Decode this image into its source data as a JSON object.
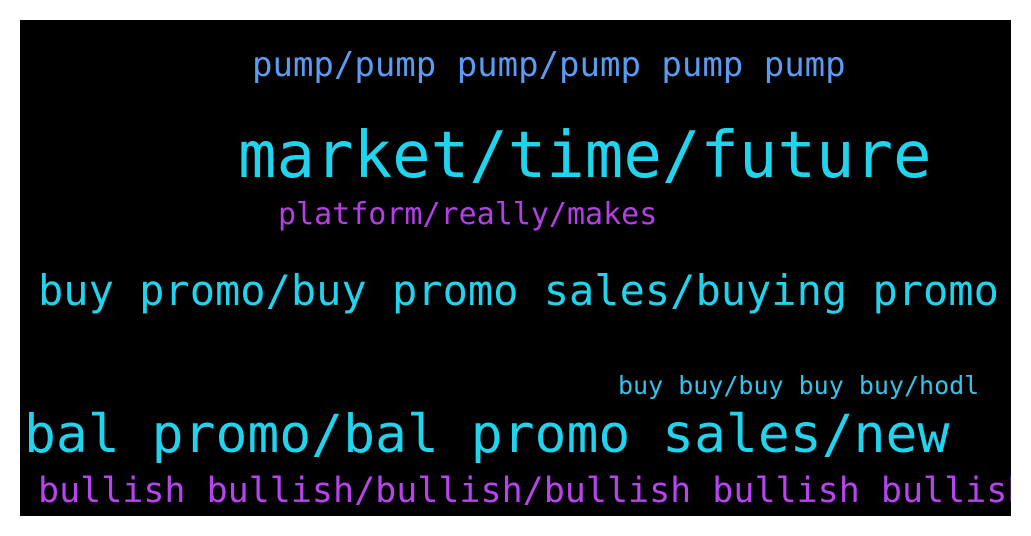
{
  "background_color": "#000000",
  "frame_color": "#ffffff",
  "words": [
    {
      "text": "pump/pump pump/pump pump pump",
      "color": "#5a9cf2"
    },
    {
      "text": "market/time/future",
      "color": "#22d3ee"
    },
    {
      "text": "platform/really/makes",
      "color": "#b43fe6"
    },
    {
      "text": "buy promo/buy promo sales/buying promo",
      "color": "#22d3ee"
    },
    {
      "text": "buy buy/buy buy buy/hodl",
      "color": "#36c3ea"
    },
    {
      "text": "bal promo/bal promo sales/new",
      "color": "#22d3ee"
    },
    {
      "text": "bullish bullish/bullish/bullish bullish bullish",
      "color": "#b844f0"
    }
  ]
}
